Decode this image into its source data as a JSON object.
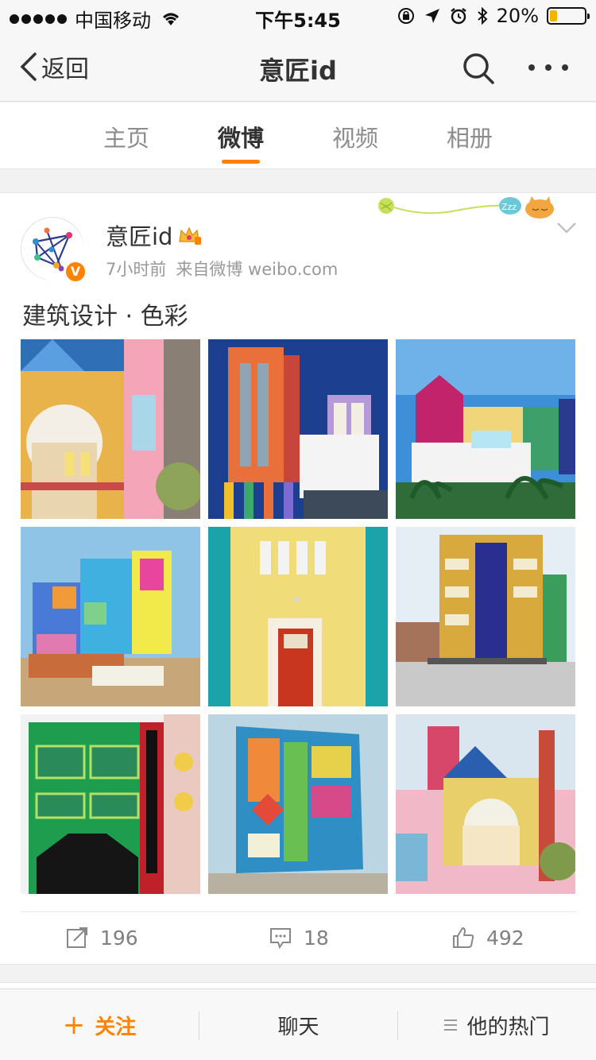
{
  "status_bar": {
    "carrier": "中国移动",
    "time": "下午5:45",
    "battery": "20%",
    "battery_level": 0.2
  },
  "nav": {
    "back_label": "返回",
    "title": "意匠id",
    "icons": [
      "chevron-left-icon",
      "search-icon",
      "more-icon"
    ]
  },
  "tabs": [
    {
      "label": "主页",
      "active": false
    },
    {
      "label": "微博",
      "active": true
    },
    {
      "label": "视频",
      "active": false
    },
    {
      "label": "相册",
      "active": false
    }
  ],
  "post": {
    "username": "意匠id",
    "verified_badge": "V",
    "time": "7小时前",
    "source": "来自微博 weibo.com",
    "text": "建筑设计 · 色彩",
    "images": [
      "colorful-building-1",
      "colorful-building-2",
      "colorful-building-3",
      "colorful-building-4",
      "colorful-building-5",
      "colorful-building-6",
      "colorful-building-7",
      "colorful-building-8",
      "colorful-building-9"
    ],
    "actions": {
      "repost_count": "196",
      "comment_count": "18",
      "like_count": "492"
    }
  },
  "bottom_bar": {
    "follow_label": "关注",
    "chat_label": "聊天",
    "hot_label": "他的热门"
  },
  "colors": {
    "accent": "#ff8200",
    "text": "#333333",
    "muted": "#999999"
  }
}
